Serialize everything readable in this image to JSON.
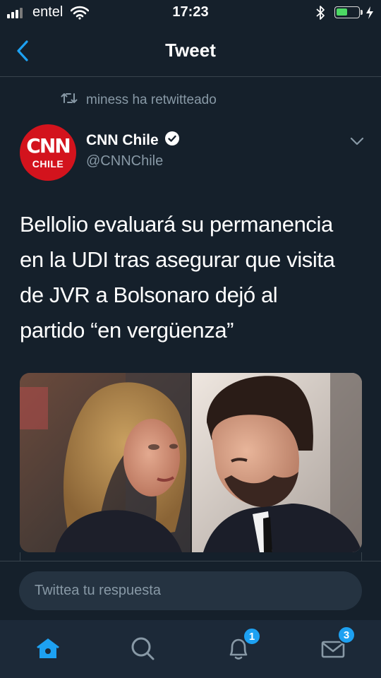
{
  "status_bar": {
    "carrier": "entel",
    "time": "17:23",
    "battery_level": 0.5
  },
  "header": {
    "title": "Tweet"
  },
  "retweet": {
    "label": "miness ha retwitteado"
  },
  "author": {
    "name": "CNN Chile",
    "handle": "@CNNChile",
    "avatar_mark": "CNN",
    "avatar_sub": "CHILE",
    "verified": true
  },
  "tweet": {
    "lines": [
      "Bellolio evaluará su permanencia",
      "en la UDI tras asegurar que visita",
      "de JVR a Bolsonaro dejó al",
      "partido “en vergüenza”"
    ]
  },
  "reply": {
    "placeholder": "Twittea tu respuesta"
  },
  "tab_bar": {
    "items": [
      {
        "icon": "home-icon",
        "active": true
      },
      {
        "icon": "search-icon",
        "active": false
      },
      {
        "icon": "notifications-icon",
        "active": false,
        "badge": "1"
      },
      {
        "icon": "messages-icon",
        "active": false,
        "badge": "3"
      }
    ]
  },
  "colors": {
    "background": "#15202b",
    "accent": "#1da1f2",
    "secondary_text": "#8899a6",
    "brand_red": "#d3131d"
  }
}
